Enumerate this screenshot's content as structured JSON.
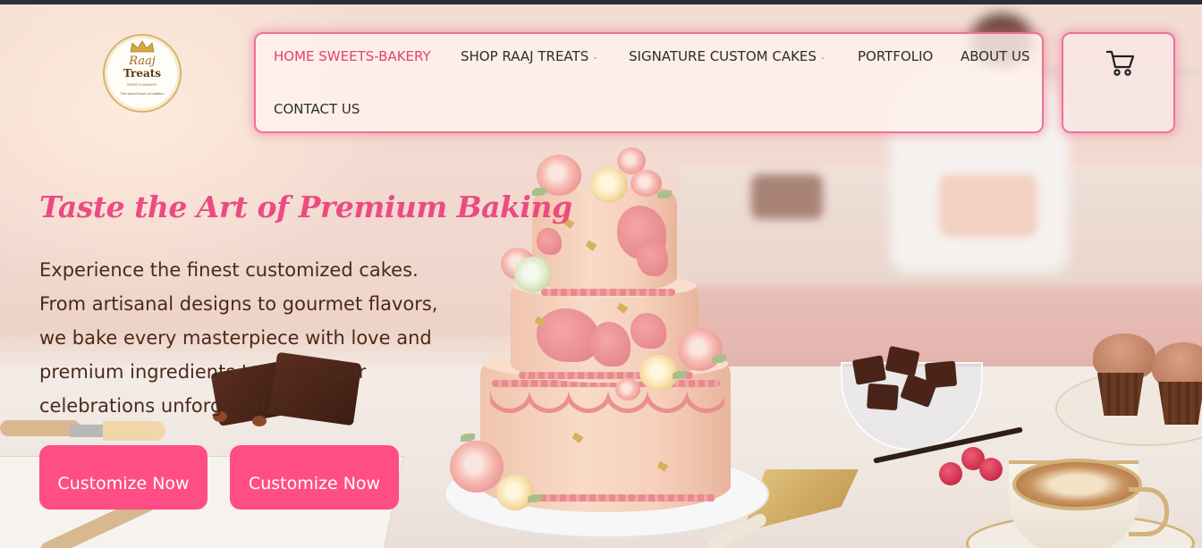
{
  "logo": {
    "line1": "Raaj",
    "line2": "Treats",
    "line3": "SWEETS BAKERY",
    "tagline": "The sweet touch of tradition"
  },
  "nav": {
    "items": [
      {
        "label": "HOME SWEETS-BAKERY",
        "active": true,
        "has_dropdown": false
      },
      {
        "label": "SHOP RAAJ TREATS",
        "active": false,
        "has_dropdown": true
      },
      {
        "label": "SIGNATURE CUSTOM CAKES",
        "active": false,
        "has_dropdown": true
      },
      {
        "label": "PORTFOLIO",
        "active": false,
        "has_dropdown": false
      },
      {
        "label": "ABOUT US",
        "active": false,
        "has_dropdown": false
      },
      {
        "label": "CONTACT US",
        "active": false,
        "has_dropdown": false
      }
    ],
    "caret": "⌄"
  },
  "cart": {
    "icon": "shopping-cart-icon"
  },
  "hero": {
    "headline": "Taste the Art of Premium Baking",
    "description": "Experience the finest customized cakes. From artisanal designs to gourmet flavors, we bake every masterpiece with love and premium ingredients to make your celebrations unforgettable.",
    "buttons": [
      {
        "label": "Customize Now"
      },
      {
        "label": "Customize Now"
      }
    ]
  },
  "colors": {
    "accent": "#ff4d86",
    "headline": "#ec4b82",
    "nav_active": "#e63e74",
    "border_glow": "#ee7196",
    "text_dark": "#4a2a1a"
  }
}
